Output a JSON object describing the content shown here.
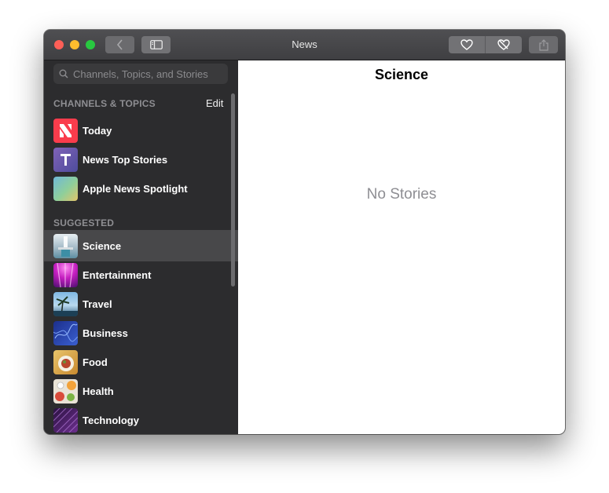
{
  "window": {
    "title": "News"
  },
  "search": {
    "placeholder": "Channels, Topics, and Stories"
  },
  "sidebar": {
    "channels_header": "CHANNELS & TOPICS",
    "edit_label": "Edit",
    "channels": [
      {
        "label": "Today",
        "icon": "apple-news-icon"
      },
      {
        "label": "News Top Stories",
        "icon": "top-stories-icon"
      },
      {
        "label": "Apple News Spotlight",
        "icon": "spotlight-icon"
      }
    ],
    "suggested_header": "SUGGESTED",
    "suggested": [
      {
        "label": "Science",
        "selected": true
      },
      {
        "label": "Entertainment"
      },
      {
        "label": "Travel"
      },
      {
        "label": "Business"
      },
      {
        "label": "Food"
      },
      {
        "label": "Health"
      },
      {
        "label": "Technology"
      }
    ]
  },
  "main": {
    "title": "Science",
    "empty_message": "No Stories"
  },
  "colors": {
    "sidebar_bg": "#2c2c2e",
    "selected_bg": "#48484a",
    "today_red": "#fa3c4c",
    "top_stories_purple": "#6d5cae"
  }
}
